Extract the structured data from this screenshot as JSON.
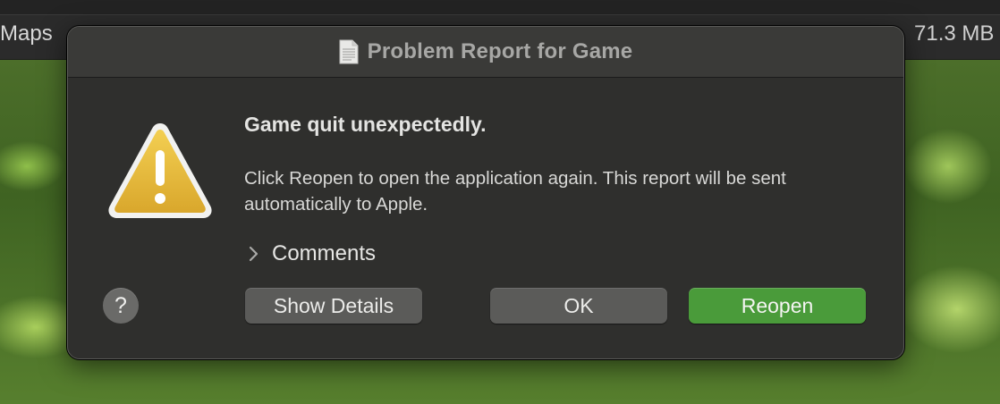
{
  "background_app": {
    "left_label": "Maps",
    "right_label": "71.3 MB"
  },
  "dialog": {
    "title": "Problem Report for Game",
    "title_icon": "document-icon",
    "warning_icon": "warning-triangle-icon",
    "headline": "Game quit unexpectedly.",
    "message": "Click Reopen to open the application again. This report will be sent automatically to Apple.",
    "comments_label": "Comments",
    "comments_expanded": false,
    "help_label": "?",
    "buttons": {
      "show_details": "Show Details",
      "ok": "OK",
      "reopen": "Reopen"
    },
    "colors": {
      "accent_button": "#4a9b3a",
      "warning_yellow": "#e6b83a",
      "dialog_bg": "#2f2f2d"
    }
  }
}
